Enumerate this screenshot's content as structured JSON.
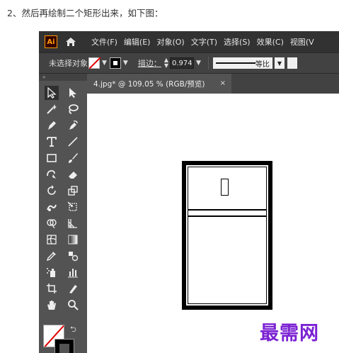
{
  "caption": "2、然后再绘制二个矩形出来，如下图：",
  "app": {
    "logo_text": "Ai",
    "menu": [
      "文件(F)",
      "编辑(E)",
      "对象(O)",
      "文字(T)",
      "选择(S)",
      "效果(C)",
      "视图(V"
    ]
  },
  "control_bar": {
    "selection_status": "未选择对象",
    "stroke_label": "描边：",
    "stroke_weight": "0.974",
    "profile_label": "等比",
    "fill_color": "none",
    "stroke_color": "#000000"
  },
  "document_tab": {
    "title": "4.jpg* @ 109.05 % (RGB/预览)",
    "close_icon": "×"
  },
  "toolbar": {
    "collapse_icon": "«",
    "fill": "none",
    "stroke": "#000000"
  },
  "watermark": "最需网",
  "colors": {
    "menubar_bg": "#323232",
    "panel_bg": "#535353",
    "control_bg": "#424242",
    "ai_logo": "#ff9a00",
    "watermark": "#7b22d3",
    "none_slash": "#e00000"
  }
}
